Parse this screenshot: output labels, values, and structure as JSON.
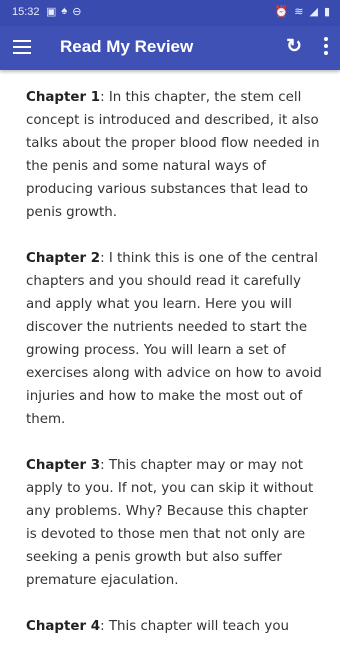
{
  "status_bar": {
    "time": "15:32",
    "left_icons": [
      "image-icon",
      "notification-icon",
      "dnd-icon"
    ],
    "right_icons": [
      "alarm-icon",
      "wifi-icon",
      "signal-icon",
      "battery-icon"
    ]
  },
  "app_bar": {
    "title": "Read My Review",
    "background": "#3f51b5"
  },
  "content": {
    "paragraphs": [
      {
        "heading": "Chapter 1",
        "text": ": In this chapter, the stem cell concept is introduced and described, it also talks about the proper blood flow needed in the penis and some natural ways of producing various substances that lead to penis growth."
      },
      {
        "heading": "Chapter 2",
        "text": ": I think this is one of the central chapters and you should read it carefully and apply what you learn. Here you will discover the nutrients needed to start the growing process. You will learn a set of exercises along with advice on how to avoid injuries and how to make the most out of them."
      },
      {
        "heading": "Chapter 3",
        "text": ": This chapter may or may not apply to you. If not, you can skip it without any problems. Why? Because this chapter is devoted to those men that not only are seeking a penis growth but also suffer premature ejaculation."
      },
      {
        "heading": "Chapter 4",
        "text": ": This chapter will teach you"
      }
    ]
  }
}
